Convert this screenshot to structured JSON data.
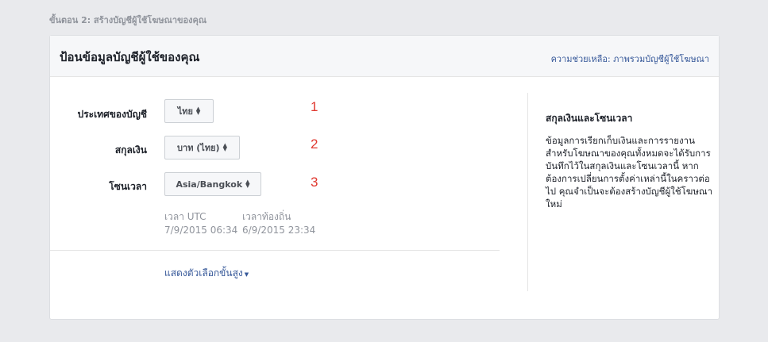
{
  "step_title": "ขั้นตอน 2: สร้างบัญชีผู้ใช้โฆษณาของคุณ",
  "card": {
    "title": "ป้อนข้อมูลบัญชีผู้ใช้ของคุณ",
    "help_link": "ความช่วยเหลือ: ภาพรวมบัญชีผู้ใช้โฆษณา"
  },
  "form": {
    "country": {
      "label": "ประเทศของบัญชี",
      "value": "ไทย",
      "marker": "1"
    },
    "currency": {
      "label": "สกุลเงิน",
      "value": "บาท (ไทย)",
      "marker": "2"
    },
    "timezone": {
      "label": "โซนเวลา",
      "value": "Asia/Bangkok",
      "marker": "3"
    }
  },
  "time_info": {
    "utc_label": "เวลา UTC",
    "utc_value": "7/9/2015 06:34",
    "local_label": "เวลาท้องถิ่น",
    "local_value": "6/9/2015 23:34"
  },
  "advanced_link": "แสดงตัวเลือกขั้นสูง",
  "sidebar": {
    "title": "สกุลเงินและโซนเวลา",
    "body": "ข้อมูลการเรียกเก็บเงินและการรายงานสำหรับโฆษณาของคุณทั้งหมดจะได้รับการบันทึกไว้ในสกุลเงินและโซนเวลานี้ หากต้องการเปลี่ยนการตั้งค่าเหล่านี้ในคราวต่อไป คุณจำเป็นจะต้องสร้างบัญชีผู้ใช้โฆษณาใหม่"
  },
  "colors": {
    "background": "#e9eaed",
    "link": "#365899",
    "marker": "#e0382f"
  },
  "icons": {
    "dropdown": "up-down-caret-icon",
    "advanced_caret": "chevron-down-icon"
  }
}
